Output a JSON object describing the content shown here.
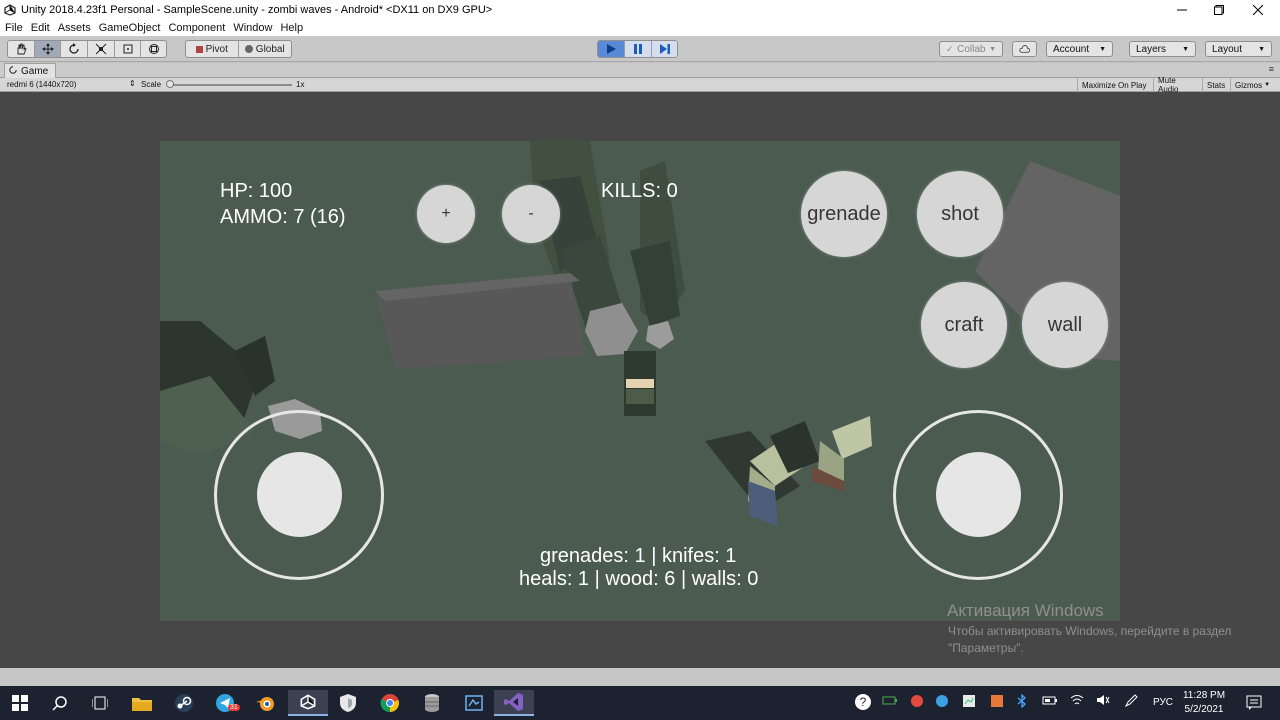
{
  "window": {
    "title": "Unity 2018.4.23f1 Personal - SampleScene.unity - zombi waves - Android* <DX11 on DX9 GPU>",
    "minimize_icon": "minimize-icon",
    "maximize_icon": "maximize-icon",
    "close_icon": "close-icon"
  },
  "menu": [
    "File",
    "Edit",
    "Assets",
    "GameObject",
    "Component",
    "Window",
    "Help"
  ],
  "toolbar": {
    "tools": [
      "hand-icon",
      "move-icon",
      "rotate-icon",
      "scale-icon",
      "rect-icon",
      "transform-icon"
    ],
    "pivot_label": "Pivot",
    "global_label": "Global",
    "play_state": "playing",
    "collab_label": "Collab",
    "account_label": "Account",
    "layers_label": "Layers",
    "layout_label": "Layout",
    "accent_color": "#5a8ad6"
  },
  "game_tab": {
    "tab_label": "Game",
    "resolution": "redmi 6 (1440x720)",
    "scale_label": "Scale",
    "scale_value": "1x",
    "maximize_on_play": "Maximize On Play",
    "mute_audio": "Mute Audio",
    "stats": "Stats",
    "gizmos": "Gizmos"
  },
  "hud": {
    "hp": "HP: 100",
    "ammo": "AMMO: 7 (16)",
    "kills": "KILLS: 0",
    "plus": "+",
    "minus": "-",
    "grenade": "grenade",
    "shot": "shot",
    "craft": "craft",
    "wall": "wall",
    "inventory_line1": "grenades: 1 | knifes: 1",
    "inventory_line2": "heals: 1 | wood: 6 | walls: 0"
  },
  "activation": {
    "title": "Активация Windows",
    "line1": "Чтобы активировать Windows, перейдите в раздел",
    "line2": "\"Параметры\"."
  },
  "taskbar": {
    "apps": [
      "windows-start-icon",
      "search-icon",
      "task-view-icon",
      "file-explorer-icon",
      "steam-icon",
      "telegram-icon",
      "blender-icon",
      "unity-icon",
      "shield-app-icon",
      "chrome-icon",
      "database-icon",
      "paint-icon",
      "visual-studio-icon"
    ],
    "telegram_badge": "31",
    "language": "РУС",
    "time": "11:28 PM",
    "date": "5/2/2021"
  }
}
